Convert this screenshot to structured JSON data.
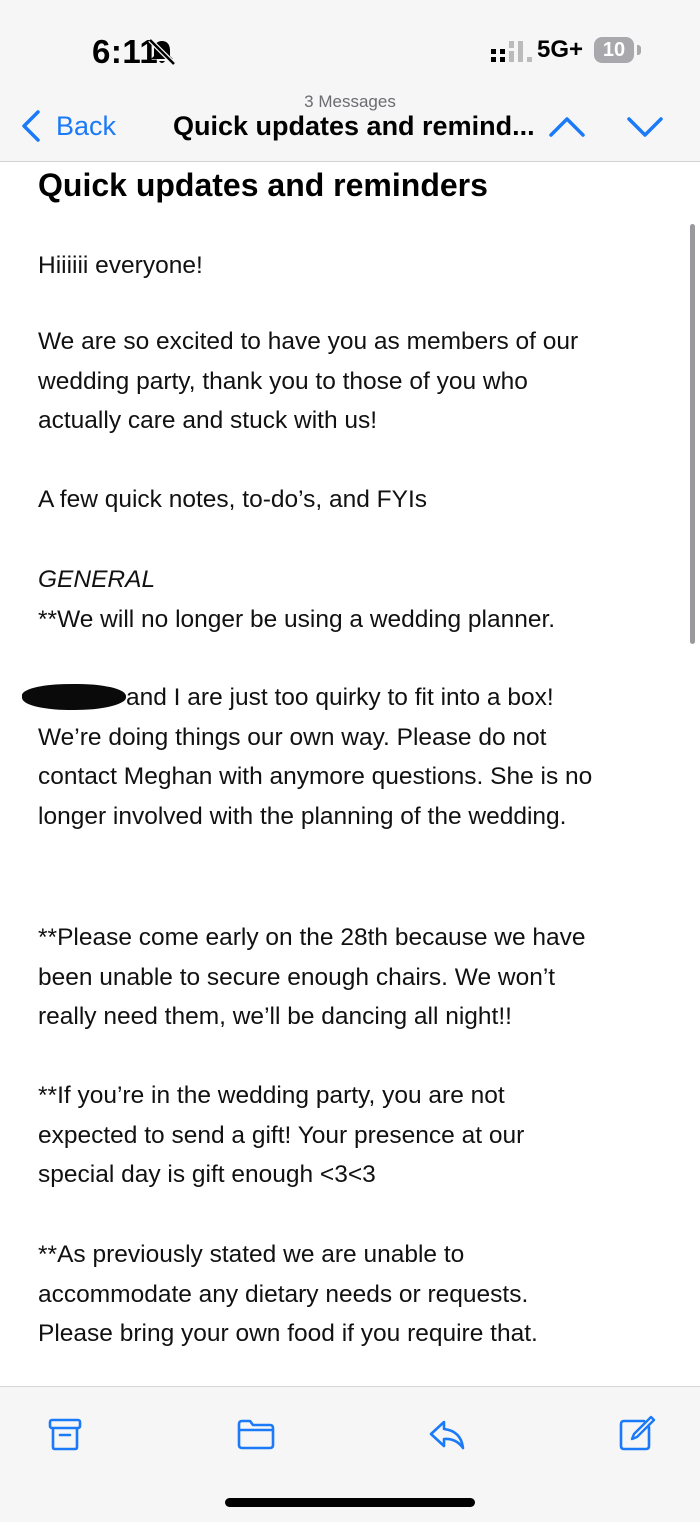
{
  "status_bar": {
    "time": "6:11",
    "network": "5G+",
    "battery": "10",
    "icons": [
      "bell-slash-icon",
      "cellular-signal-icon"
    ]
  },
  "nav": {
    "back_label": "Back",
    "message_count": "3 Messages",
    "title": "Quick updates and remind...",
    "icons": [
      "chevron-left-icon",
      "chevron-up-icon",
      "chevron-down-icon"
    ]
  },
  "email": {
    "subject": "Quick updates and reminders",
    "greeting": "Hiiiiii everyone!",
    "intro": [
      "We are so excited to have you as members of our",
      "wedding party, thank you to those of you who",
      "actually care and stuck with us!"
    ],
    "notes_heading": "A few quick notes, to-do’s, and FYIs",
    "section_heading": "GENERAL",
    "planner_note": "**We will no longer be using a wedding planner.",
    "quirky_first_line": "and I are just too quirky to fit into a box!",
    "quirky_lines": [
      "We’re doing things our own way. Please do not",
      "contact Meghan with anymore questions. She is no",
      "longer involved with the planning of the wedding."
    ],
    "chairs": [
      "**Please come early on the 28th because we have",
      "been unable to secure enough chairs. We won’t",
      "really need them, we’ll be dancing all night!!"
    ],
    "gift": [
      "**If you’re in the wedding party, you are not",
      "expected to send a gift! Your presence at our",
      "special day is gift enough <3<3"
    ],
    "dietary": [
      "**As previously stated we are unable to",
      "accommodate any dietary needs or requests.",
      "Please bring your own food if you require that."
    ]
  },
  "toolbar": {
    "icons": [
      "archive-icon",
      "folder-icon",
      "reply-icon",
      "compose-icon"
    ]
  },
  "colors": {
    "accent": "#1a7af7",
    "bar_background": "#f6f6f7",
    "battery": "#a9a9ad"
  }
}
